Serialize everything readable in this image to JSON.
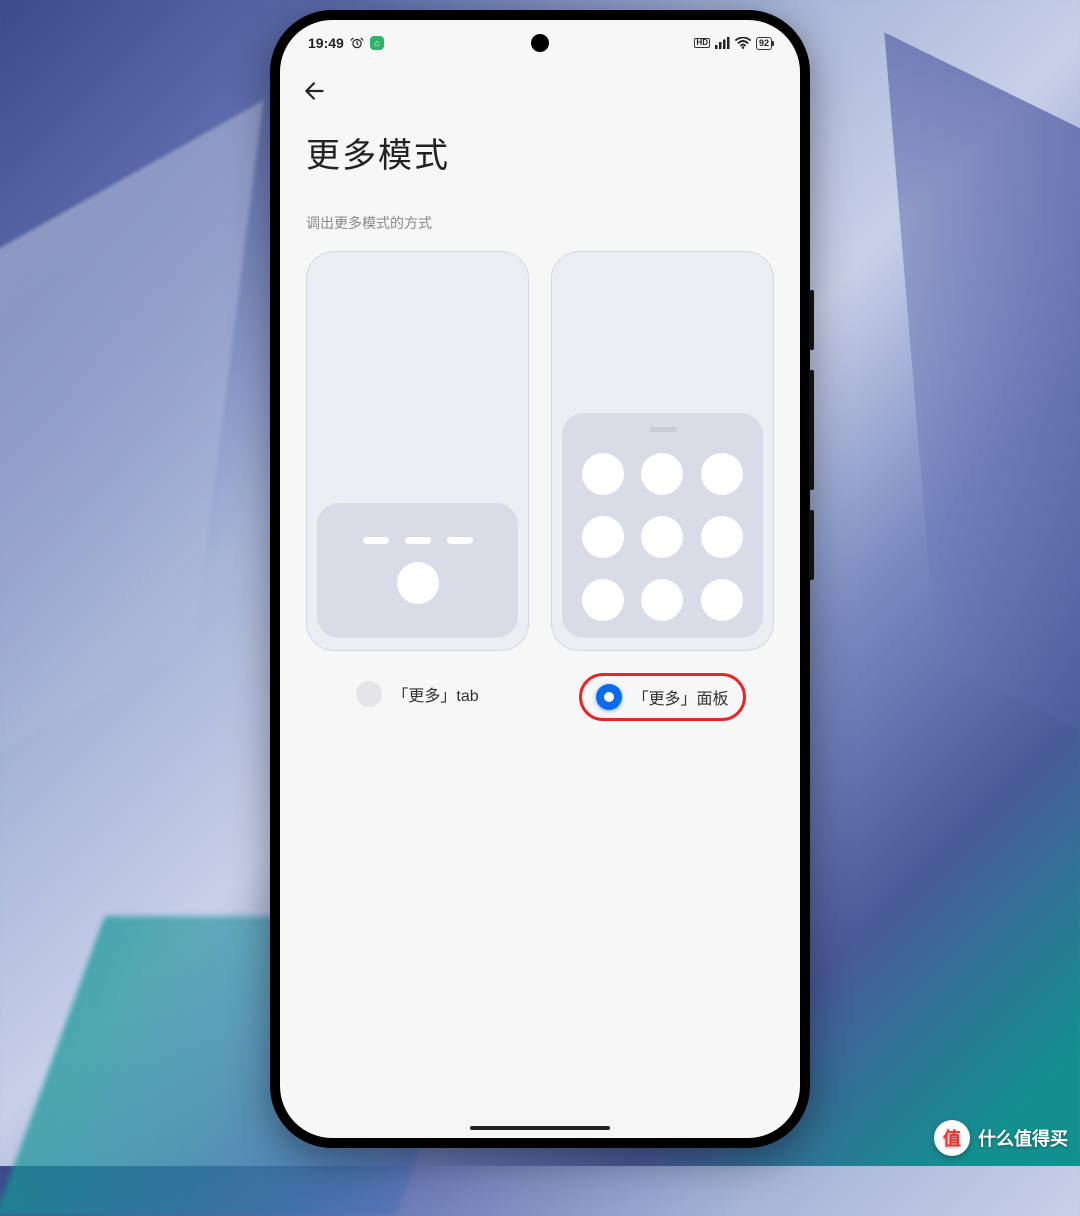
{
  "status": {
    "time": "19:49",
    "battery": "92"
  },
  "page": {
    "title": "更多模式",
    "subtitle": "调出更多模式的方式"
  },
  "options": {
    "tab": {
      "label": "「更多」tab",
      "selected": false
    },
    "panel": {
      "label": "「更多」面板",
      "selected": true
    }
  },
  "watermark": {
    "badge": "值",
    "text": "什么值得买"
  }
}
